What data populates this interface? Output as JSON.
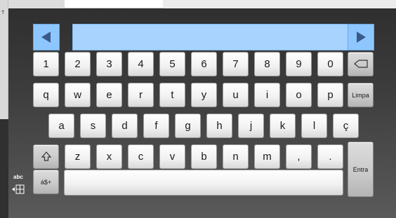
{
  "background": {
    "corner_text": "T"
  },
  "keyboard": {
    "row1": [
      "1",
      "2",
      "3",
      "4",
      "5",
      "6",
      "7",
      "8",
      "9",
      "0"
    ],
    "row2": [
      "q",
      "w",
      "e",
      "r",
      "t",
      "y",
      "u",
      "i",
      "o",
      "p"
    ],
    "row3": [
      "a",
      "s",
      "d",
      "f",
      "g",
      "h",
      "j",
      "k",
      "l",
      "ç"
    ],
    "row4": [
      "z",
      "x",
      "c",
      "v",
      "b",
      "n",
      "m",
      ",",
      "."
    ],
    "clear_label": "Limpa",
    "enter_label": "Entra",
    "symbols_label": "á$+",
    "mode_label": "abc",
    "icons": {
      "left": "arrow-left-icon",
      "right": "arrow-right-icon",
      "backspace": "backspace-icon",
      "shift": "shift-icon",
      "keyboard_mode": "keyboard-mode-icon"
    },
    "colors": {
      "accent": "#8ec7ff",
      "display": "#a8d3ff",
      "panel": "#3b3b3b"
    }
  }
}
